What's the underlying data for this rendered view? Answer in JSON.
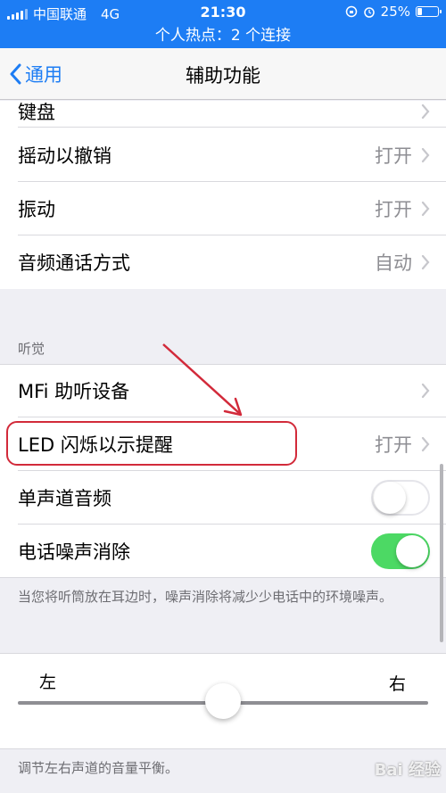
{
  "status_bar": {
    "carrier": "中国联通",
    "network": "4G",
    "time": "21:30",
    "battery": "25%",
    "battery_level": 0.25
  },
  "hotspot": {
    "text": "个人热点：2 个连接"
  },
  "navbar": {
    "back_label": "通用",
    "title": "辅助功能"
  },
  "rows_top": [
    {
      "label": "键盘",
      "value": ""
    },
    {
      "label": "摇动以撤销",
      "value": "打开"
    },
    {
      "label": "振动",
      "value": "打开"
    },
    {
      "label": "音频通话方式",
      "value": "自动"
    }
  ],
  "hearing": {
    "header": "听觉",
    "rows": [
      {
        "label": "MFi 助听设备",
        "value": ""
      },
      {
        "label": "LED 闪烁以示提醒",
        "value": "打开"
      },
      {
        "label": "单声道音频",
        "toggle": false
      },
      {
        "label": "电话噪声消除",
        "toggle": true
      }
    ],
    "footer": "当您将听筒放在耳边时，噪声消除将减少少电话中的环境噪声。"
  },
  "balance": {
    "left_label": "左",
    "right_label": "右",
    "value": 0.5,
    "footer": "调节左右声道的音量平衡。"
  },
  "colors": {
    "accent": "#1d7df4",
    "toggle_on": "#4cd964",
    "highlight": "#d22a3a"
  },
  "watermark": "Bai 经验"
}
